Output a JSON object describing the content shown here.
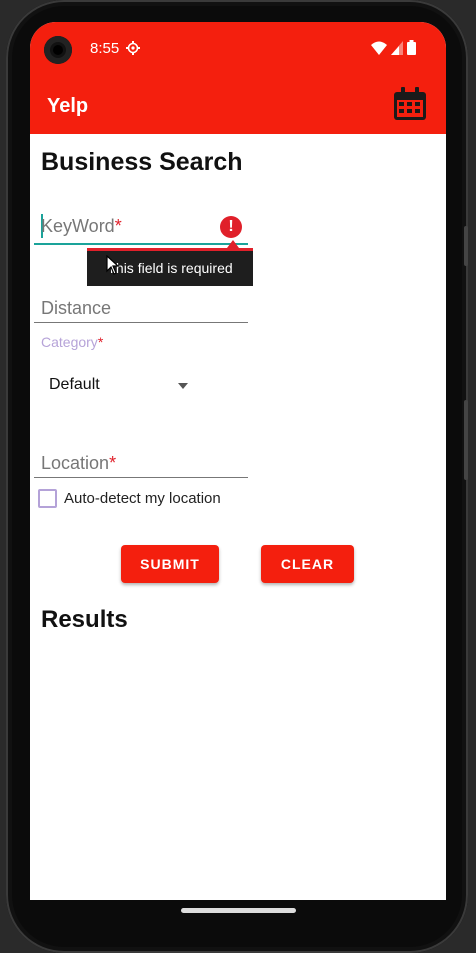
{
  "status_bar": {
    "time": "8:55"
  },
  "app_bar": {
    "title": "Yelp"
  },
  "form": {
    "heading": "Business Search",
    "keyword": {
      "label": "KeyWord",
      "required_mark": "*",
      "error": "This field is required"
    },
    "distance": {
      "label": "Distance"
    },
    "category": {
      "label": "Category",
      "required_mark": "*",
      "selected": "Default"
    },
    "location": {
      "label": "Location",
      "required_mark": "*"
    },
    "auto_detect": {
      "label": "Auto-detect my location",
      "checked": false
    },
    "submit_label": "SUBMIT",
    "clear_label": "CLEAR"
  },
  "results": {
    "heading": "Results"
  },
  "colors": {
    "accent": "#f41f0e",
    "focus": "#1aa39a",
    "error": "#e0202a",
    "checkbox": "#b4a2d8"
  },
  "icons": [
    "camera-icon",
    "sync-icon",
    "wifi-icon",
    "signal-icon",
    "battery-icon",
    "calendar-icon",
    "error-icon",
    "dropdown-caret-icon"
  ]
}
